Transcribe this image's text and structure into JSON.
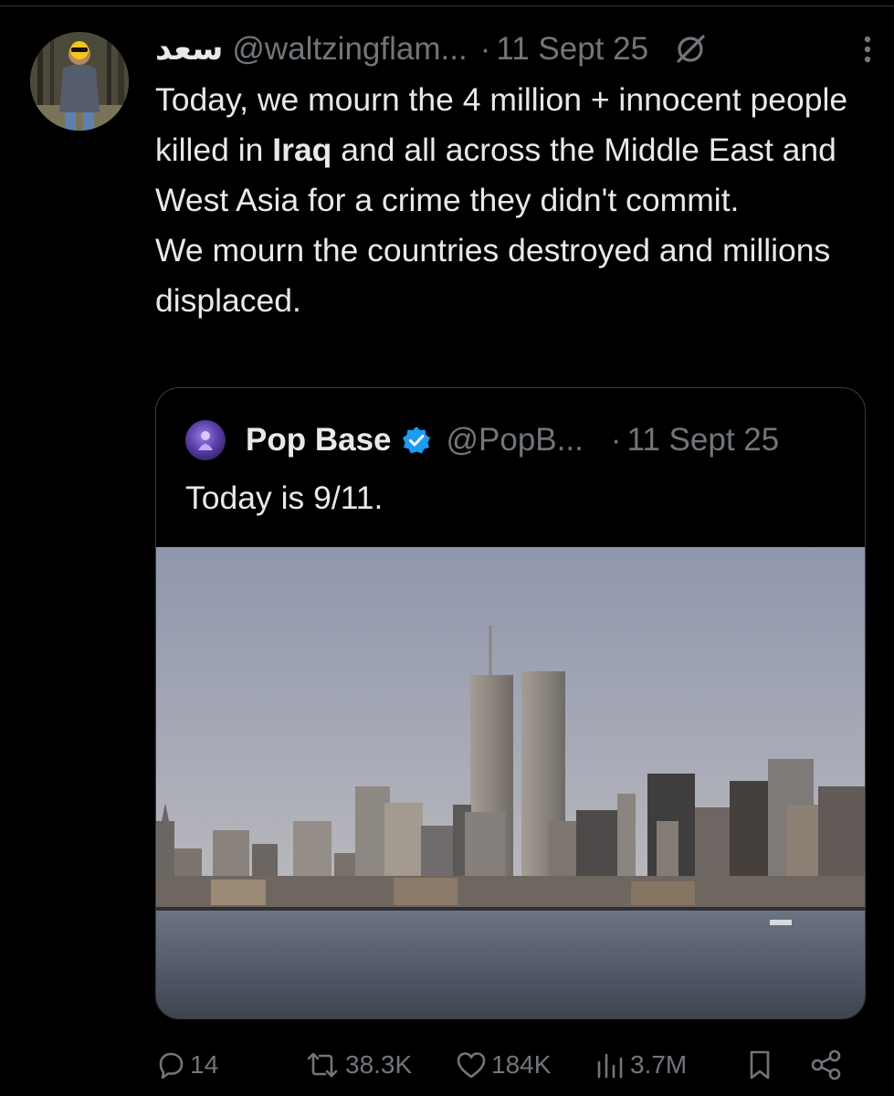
{
  "tweet": {
    "author_name": "سعد",
    "author_handle": "@waltzingflam...",
    "separator": "·",
    "date": "11 Sept 25",
    "text": {
      "line1": "Today, we mourn the 4 million + innocent people killed in ",
      "bold": "Iraq",
      "line1_end": " and all across the Middle East and West Asia for a crime they didn't commit.",
      "line2": "We mourn the countries destroyed and millions displaced."
    }
  },
  "quoted_tweet": {
    "author_name": "Pop Base",
    "author_handle": "@PopB...",
    "separator": "·",
    "date": "11 Sept 25",
    "text": "Today is 9/11."
  },
  "actions": {
    "replies": "14",
    "reposts": "38.3K",
    "likes": "184K",
    "views": "3.7M"
  },
  "icons": [
    "grok-icon",
    "more-icon",
    "verified-icon",
    "reply-icon",
    "repost-icon",
    "like-icon",
    "views-icon",
    "bookmark-icon",
    "share-icon"
  ],
  "colors": {
    "background": "#000000",
    "text": "#e7e9ea",
    "muted": "#71767b",
    "verified": "#1d9bf0"
  }
}
